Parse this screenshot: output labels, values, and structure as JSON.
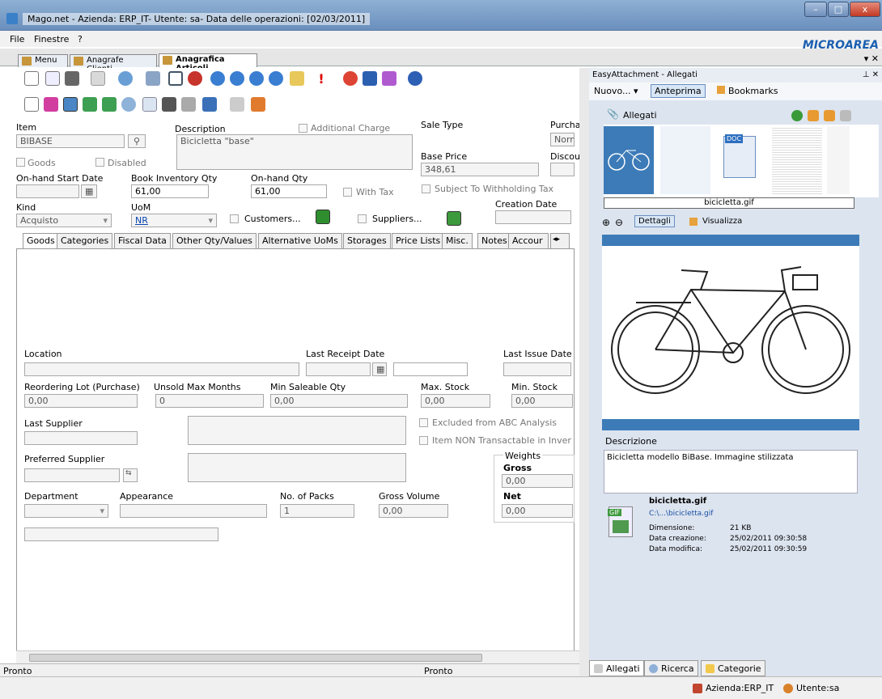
{
  "window": {
    "title": "Mago.net - Azienda: ERP_IT- Utente: sa- Data delle operazioni: [02/03/2011]",
    "min": "–",
    "max": "□",
    "close": "x"
  },
  "menu": {
    "file": "File",
    "finestre": "Finestre",
    "help": "?",
    "logo": "MICROAREA",
    "close_x": "▾ ✕"
  },
  "tabs": [
    "Menu",
    "Anagrafe Clienti",
    "Anagrafica Articoli"
  ],
  "form": {
    "item_label": "Item",
    "item_value": "BIBASE",
    "description_label": "Description",
    "description_value": "Bicicletta \"base\"",
    "additional_charge": "Additional Charge",
    "sale_type_label": "Sale Type",
    "purchase_label": "Purcha",
    "purchase_value": "Norma",
    "goods": "Goods",
    "disabled": "Disabled",
    "base_price_label": "Base Price",
    "base_price_value": "348,61",
    "discount_label": "Discou",
    "onhand_start_label": "On-hand Start Date",
    "book_inv_label": "Book Inventory Qty",
    "book_inv_value": "61,00",
    "onhand_qty_label": "On-hand Qty",
    "onhand_qty_value": "61,00",
    "with_tax": "With Tax",
    "subject_withholding": "Subject To Withholding Tax",
    "creation_date_label": "Creation Date",
    "kind_label": "Kind",
    "kind_value": "Acquisto",
    "uom_label": "UoM",
    "uom_value": "NR",
    "customers": "Customers...",
    "suppliers": "Suppliers..."
  },
  "subtabs": [
    "Goods",
    "Categories",
    "Fiscal Data",
    "Other Qty/Values",
    "Alternative UoMs",
    "Storages",
    "Price Lists",
    "Misc.",
    "Notes",
    "Accour"
  ],
  "goods": {
    "location": "Location",
    "last_receipt": "Last Receipt Date",
    "last_issue": "Last Issue Date",
    "reorder_lot": "Reordering Lot (Purchase)",
    "reorder_lot_value": "0,00",
    "unsold_max": "Unsold Max Months",
    "unsold_max_value": "0",
    "min_saleable": "Min Saleable Qty",
    "min_saleable_value": "0,00",
    "max_stock": "Max. Stock",
    "max_stock_value": "0,00",
    "min_stock": "Min. Stock",
    "min_stock_value": "0,00",
    "last_supplier": "Last Supplier",
    "excluded_abc": "Excluded from ABC Analysis",
    "non_transactable": "Item NON Transactable in Inver",
    "preferred_supplier": "Preferred Supplier",
    "weights": "Weights",
    "gross": "Gross",
    "gross_value": "0,00",
    "net": "Net",
    "net_value": "0,00",
    "department": "Department",
    "appearance": "Appearance",
    "packs": "No. of Packs",
    "packs_value": "1",
    "gross_volume": "Gross Volume",
    "gross_volume_value": "0,00"
  },
  "status": {
    "left": "Pronto",
    "mid": "Pronto",
    "company": "Azienda:ERP_IT",
    "user": "Utente:sa"
  },
  "attach": {
    "header": "EasyAttachment - Allegati",
    "pin": "⊥ ✕",
    "nuovo": "Nuovo...",
    "anteprima": "Anteprima",
    "bookmarks": "Bookmarks",
    "allegati": "Allegati",
    "filename_sel": "bicicletta.gif",
    "dettagli": "Dettagli",
    "visualizza": "Visualizza",
    "descrizione_label": "Descrizione",
    "descrizione_value": "Bicicletta modello BiBase. Immagine stilizzata",
    "file_name": "bicicletta.gif",
    "file_path": "C:\\...\\bicicletta.gif",
    "dim_label": "Dimensione:",
    "dim_value": "21 KB",
    "created_label": "Data creazione:",
    "created_value": "25/02/2011 09:30:58",
    "modified_label": "Data modifica:",
    "modified_value": "25/02/2011 09:30:59",
    "tab_allegati": "Allegati",
    "tab_ricerca": "Ricerca",
    "tab_categorie": "Categorie",
    "gif_badge": "GIF",
    "doc_badge": "DOC"
  }
}
